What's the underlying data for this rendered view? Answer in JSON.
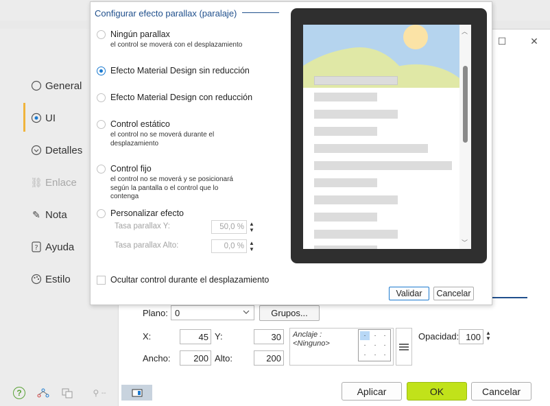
{
  "background": {
    "nav_items": [
      {
        "label": "General",
        "icon": "radio-circle-icon"
      },
      {
        "label": "UI",
        "icon": "eye-icon"
      },
      {
        "label": "Detalles",
        "icon": "chevron-circle-icon"
      },
      {
        "label": "Enlace",
        "icon": "link-icon"
      },
      {
        "label": "Nota",
        "icon": "pencil-icon"
      },
      {
        "label": "Ayuda",
        "icon": "help-icon"
      },
      {
        "label": "Estilo",
        "icon": "palette-icon"
      }
    ],
    "form": {
      "plano_label": "Plano:",
      "plano_value": "0",
      "grupos_button": "Grupos...",
      "x_label": "X:",
      "x_value": "45",
      "y_label": "Y:",
      "y_value": "30",
      "ancho_label": "Ancho:",
      "ancho_value": "200",
      "alto_label": "Alto:",
      "alto_value": "200",
      "anchor_text_1": "Anclaje :",
      "anchor_text_2": "<Ninguno>",
      "opacidad_label": "Opacidad:",
      "opacidad_value": "100"
    },
    "buttons": {
      "apply": "Aplicar",
      "ok": "OK",
      "cancel": "Cancelar"
    },
    "bottom_toolbar": {
      "help": "?",
      "dash": "--"
    }
  },
  "popup": {
    "title": "Configurar efecto parallax (paralaje)",
    "options": [
      {
        "label": "Ningún parallax",
        "desc": [
          "el control se moverá con el desplazamiento"
        ],
        "checked": false
      },
      {
        "label": "Efecto Material Design sin reducción",
        "desc": [],
        "checked": true
      },
      {
        "label": "Efecto Material Design con reducción",
        "desc": [],
        "checked": false
      },
      {
        "label": "Control estático",
        "desc": [
          "el control no se moverá durante el",
          "desplazamiento"
        ],
        "checked": false
      },
      {
        "label": "Control fijo",
        "desc": [
          "el control no se moverá y se posicionará",
          "según la pantalla o el control que lo",
          "contenga"
        ],
        "checked": false
      },
      {
        "label": "Personalizar efecto",
        "desc": [],
        "checked": false
      }
    ],
    "tasa_y_label": "Tasa parallax Y:",
    "tasa_y_value": "50,0 %",
    "tasa_alto_label": "Tasa parallax Alto:",
    "tasa_alto_value": "0,0 %",
    "hide_checkbox_label": "Ocultar control durante el desplazamiento",
    "validate_button": "Validar",
    "cancel_button": "Cancelar"
  },
  "colors": {
    "accent_blue": "#1b7ad0",
    "title_blue": "#1f4f8c",
    "ok_green": "#c1e21a",
    "nav_active": "#f0b43c",
    "preview_sky": "#b5d4ee",
    "preview_hill": "#e0e8a6",
    "preview_sun": "#fbe3a6"
  }
}
